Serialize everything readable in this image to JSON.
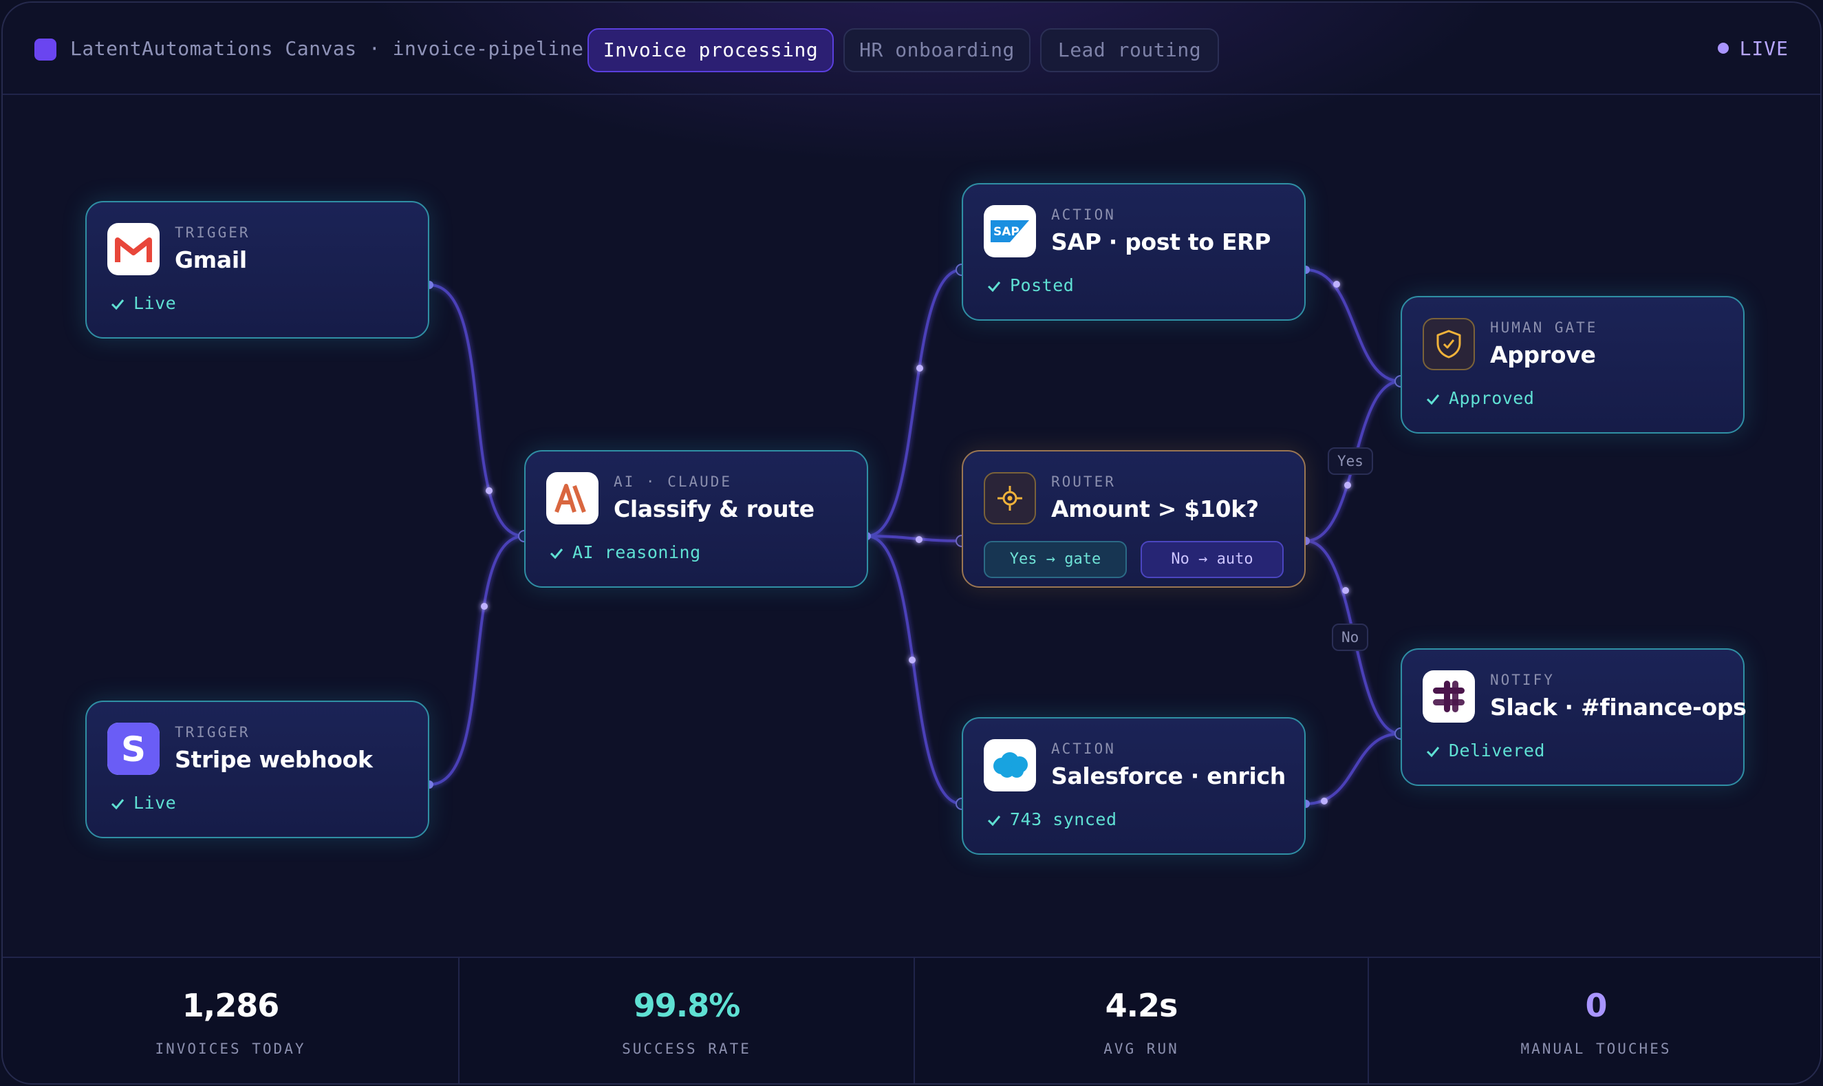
{
  "header": {
    "brand": "LatentAutomations Canvas · invoice-pipeline",
    "tabs": [
      {
        "label": "Invoice processing",
        "active": true
      },
      {
        "label": "HR onboarding",
        "active": false
      },
      {
        "label": "Lead routing",
        "active": false
      }
    ],
    "live_label": "LIVE"
  },
  "nodes": {
    "gmail": {
      "kicker": "TRIGGER",
      "title": "Gmail",
      "status": "Live",
      "icon": "gmail-icon"
    },
    "stripe": {
      "kicker": "TRIGGER",
      "title": "Stripe webhook",
      "status": "Live",
      "icon": "stripe-icon"
    },
    "claude": {
      "kicker": "AI · CLAUDE",
      "title": "Classify & route",
      "status": "AI reasoning",
      "icon": "anthropic-icon"
    },
    "sap": {
      "kicker": "ACTION",
      "title": "SAP · post to ERP",
      "status": "Posted",
      "icon": "sap-icon"
    },
    "router": {
      "kicker": "ROUTER",
      "title": "Amount > $10k?",
      "chip_yes": "Yes → gate",
      "chip_no": "No → auto",
      "icon": "crosshair-icon"
    },
    "salesforce": {
      "kicker": "ACTION",
      "title": "Salesforce · enrich",
      "status": "743 synced",
      "icon": "salesforce-icon"
    },
    "approve": {
      "kicker": "HUMAN GATE",
      "title": "Approve",
      "status": "Approved",
      "icon": "shield-check-icon"
    },
    "slack": {
      "kicker": "NOTIFY",
      "title": "Slack · #finance-ops",
      "status": "Delivered",
      "icon": "slack-icon"
    }
  },
  "edge_labels": {
    "yes": "Yes",
    "no": "No"
  },
  "stats": [
    {
      "value": "1,286",
      "label": "INVOICES TODAY",
      "color": "#ffffff"
    },
    {
      "value": "99.8%",
      "label": "SUCCESS RATE",
      "color": "#5fe0d3"
    },
    {
      "value": "4.2s",
      "label": "AVG RUN",
      "color": "#ffffff"
    },
    {
      "value": "0",
      "label": "MANUAL TOUCHES",
      "color": "#a995ff"
    }
  ],
  "colors": {
    "accent": "#6a45f0",
    "teal": "#5fe0d3",
    "edge": "#5a4fd0",
    "router_border": "#9a7652"
  }
}
